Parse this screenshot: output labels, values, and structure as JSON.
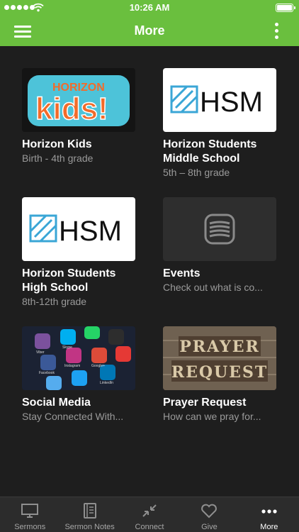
{
  "status_bar": {
    "time": "10:26 AM"
  },
  "header": {
    "title": "More"
  },
  "cards": [
    {
      "title": "Horizon Kids",
      "subtitle": "Birth - 4th grade",
      "logo_top": "HORIZON",
      "logo_bottom": "kids!",
      "image": "horizon-kids-logo"
    },
    {
      "title": "Horizon Students Middle School",
      "subtitle": "5th – 8th grade",
      "logo": "HSM",
      "image": "hsm-logo"
    },
    {
      "title": "Horizon Students High School",
      "subtitle": "8th-12th grade",
      "logo": "HSM",
      "image": "hsm-logo"
    },
    {
      "title": "Events",
      "subtitle": "Check out what is co...",
      "image": "events-icon"
    },
    {
      "title": "Social Media",
      "subtitle": "Stay Connected With...",
      "image": "social-media-apps-photo",
      "app_labels": [
        "Viber",
        "Skype",
        "Instagram",
        "Google+",
        "Facebook",
        "LinkedIn"
      ]
    },
    {
      "title": "Prayer Request",
      "subtitle": "How can we pray for...",
      "image": "prayer-request-photo",
      "photo_line1": "PRAYER",
      "photo_line2": "REQUEST"
    }
  ],
  "tabs": [
    {
      "label": "Sermons",
      "icon": "monitor-icon",
      "active": false
    },
    {
      "label": "Sermon Notes",
      "icon": "notebook-icon",
      "active": false
    },
    {
      "label": "Connect",
      "icon": "arrows-connect-icon",
      "active": false
    },
    {
      "label": "Give",
      "icon": "heart-icon",
      "active": false
    },
    {
      "label": "More",
      "icon": "ellipsis-icon",
      "active": true
    }
  ],
  "colors": {
    "brand_green": "#6abf3e",
    "background": "#1e1e1e",
    "tabbar": "#2c2c2c",
    "subtitle": "#9a9a9a"
  }
}
